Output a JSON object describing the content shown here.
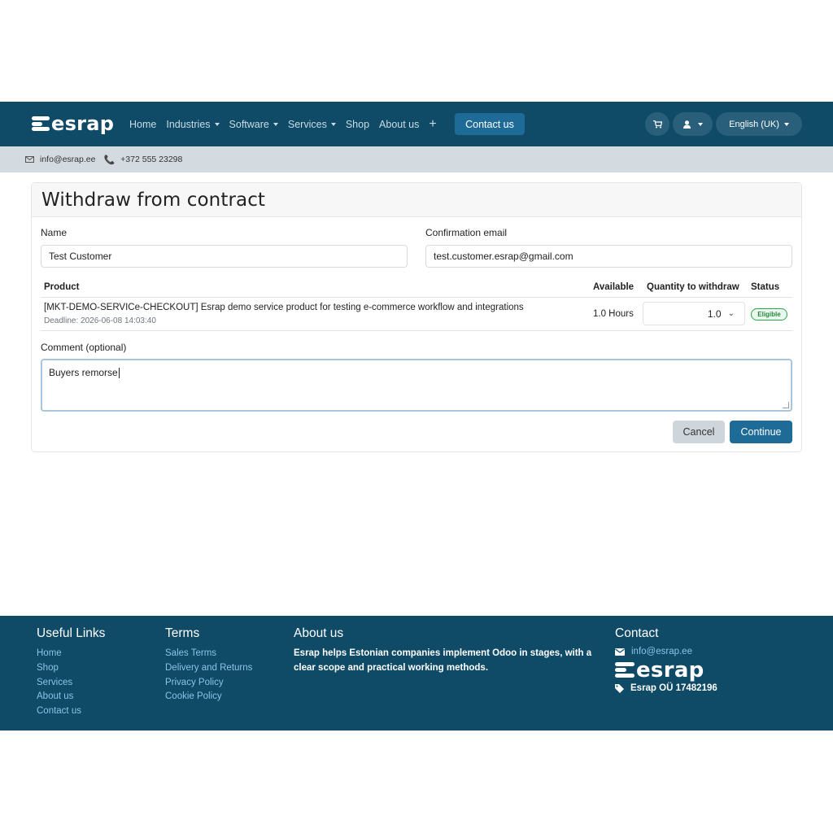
{
  "header": {
    "logo_text": "esrap",
    "nav": [
      {
        "label": "Home",
        "dropdown": false
      },
      {
        "label": "Industries",
        "dropdown": true
      },
      {
        "label": "Software",
        "dropdown": true
      },
      {
        "label": "Services",
        "dropdown": true
      },
      {
        "label": "Shop",
        "dropdown": false
      },
      {
        "label": "About us",
        "dropdown": false
      }
    ],
    "plus_label": "+",
    "contact_button": "Contact us",
    "cart_icon": "🛒",
    "user_icon": "👤",
    "language": "English (UK)"
  },
  "subbar": {
    "email": "info@esrap.ee",
    "phone": "+372 555 23298"
  },
  "form": {
    "title": "Withdraw from contract",
    "name_label": "Name",
    "name_value": "Test Customer",
    "email_label": "Confirmation email",
    "email_value": "test.customer.esrap@gmail.com",
    "table": {
      "headers": {
        "product": "Product",
        "available": "Available",
        "quantity": "Quantity to withdraw",
        "status": "Status"
      },
      "rows": [
        {
          "product": "[MKT-DEMO-SERVICe-CHECKOUT] Esrap demo service product for testing e-commerce workflow and integrations",
          "deadline": "Deadline: 2026-06-08 14:03:40",
          "available": "1.0 Hours",
          "quantity": "1.0",
          "status": "Eligible"
        }
      ]
    },
    "comment_label": "Comment (optional)",
    "comment_value": "Buyers remorse",
    "cancel_label": "Cancel",
    "continue_label": "Continue"
  },
  "footer": {
    "useful_links": {
      "heading": "Useful Links",
      "items": [
        "Home",
        "Shop",
        "Services",
        "About us",
        "Contact us"
      ]
    },
    "terms": {
      "heading": "Terms",
      "items": [
        "Sales Terms",
        "Delivery and Returns",
        "Privacy Policy",
        "Cookie Policy"
      ]
    },
    "about": {
      "heading": "About us",
      "text": "Esrap helps Estonian companies implement Odoo in stages, with a clear scope and practical working methods."
    },
    "contact": {
      "heading": "Contact",
      "email": "info@esrap.ee",
      "logo_text": "esrap",
      "company": "Esrap OÜ 17482196"
    }
  },
  "colors": {
    "brand_dark": "#0f4a66",
    "accent": "#1e6b98",
    "eligible": "#28a745",
    "footer_link": "#8cc3e8"
  }
}
